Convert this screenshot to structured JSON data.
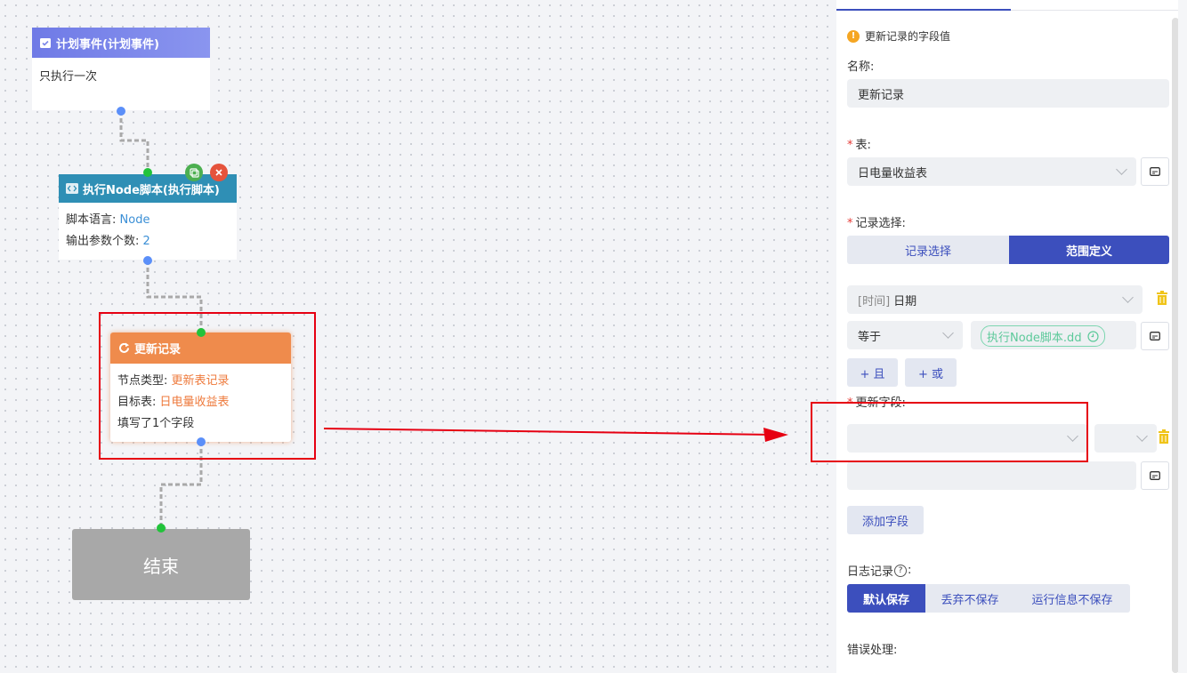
{
  "canvas": {
    "schedule_node": {
      "title": "计划事件(计划事件)",
      "body": "只执行一次"
    },
    "script_node": {
      "title": "执行Node脚本(执行脚本)",
      "lang_label": "脚本语言: ",
      "lang_value": "Node",
      "outputs_label": "输出参数个数: ",
      "outputs_value": "2"
    },
    "update_node": {
      "title": "更新记录",
      "type_label": "节点类型: ",
      "type_value": "更新表记录",
      "table_label": "目标表: ",
      "table_value": "日电量收益表",
      "filled": "填写了1个字段"
    },
    "end_node": {
      "label": "结束"
    },
    "colors": {
      "schedule_header": "#7b86e8",
      "script_header": "#2f8fb5",
      "update_header": "#ef8b4c",
      "highlight": "#e60012"
    }
  },
  "panel": {
    "warning_text": "更新记录的字段值",
    "name_label": "名称:",
    "name_value": "更新记录",
    "table_label": "表:",
    "table_value": "日电量收益表",
    "record_label": "记录选择:",
    "record_tabs": [
      "记录选择",
      "范围定义"
    ],
    "record_active": "范围定义",
    "cond_field_prefix": "[时间]",
    "cond_field_value": "日期",
    "cond_op": "等于",
    "cond_value_tag": "执行Node脚本.dd",
    "and_button": "+ 且",
    "or_button": "+ 或",
    "update_fields_label": "更新字段:",
    "add_field_button": "添加字段",
    "log_label": "日志记录",
    "log_options": [
      "默认保存",
      "丢弃不保存",
      "运行信息不保存"
    ],
    "log_active": "默认保存",
    "error_label": "错误处理:"
  }
}
